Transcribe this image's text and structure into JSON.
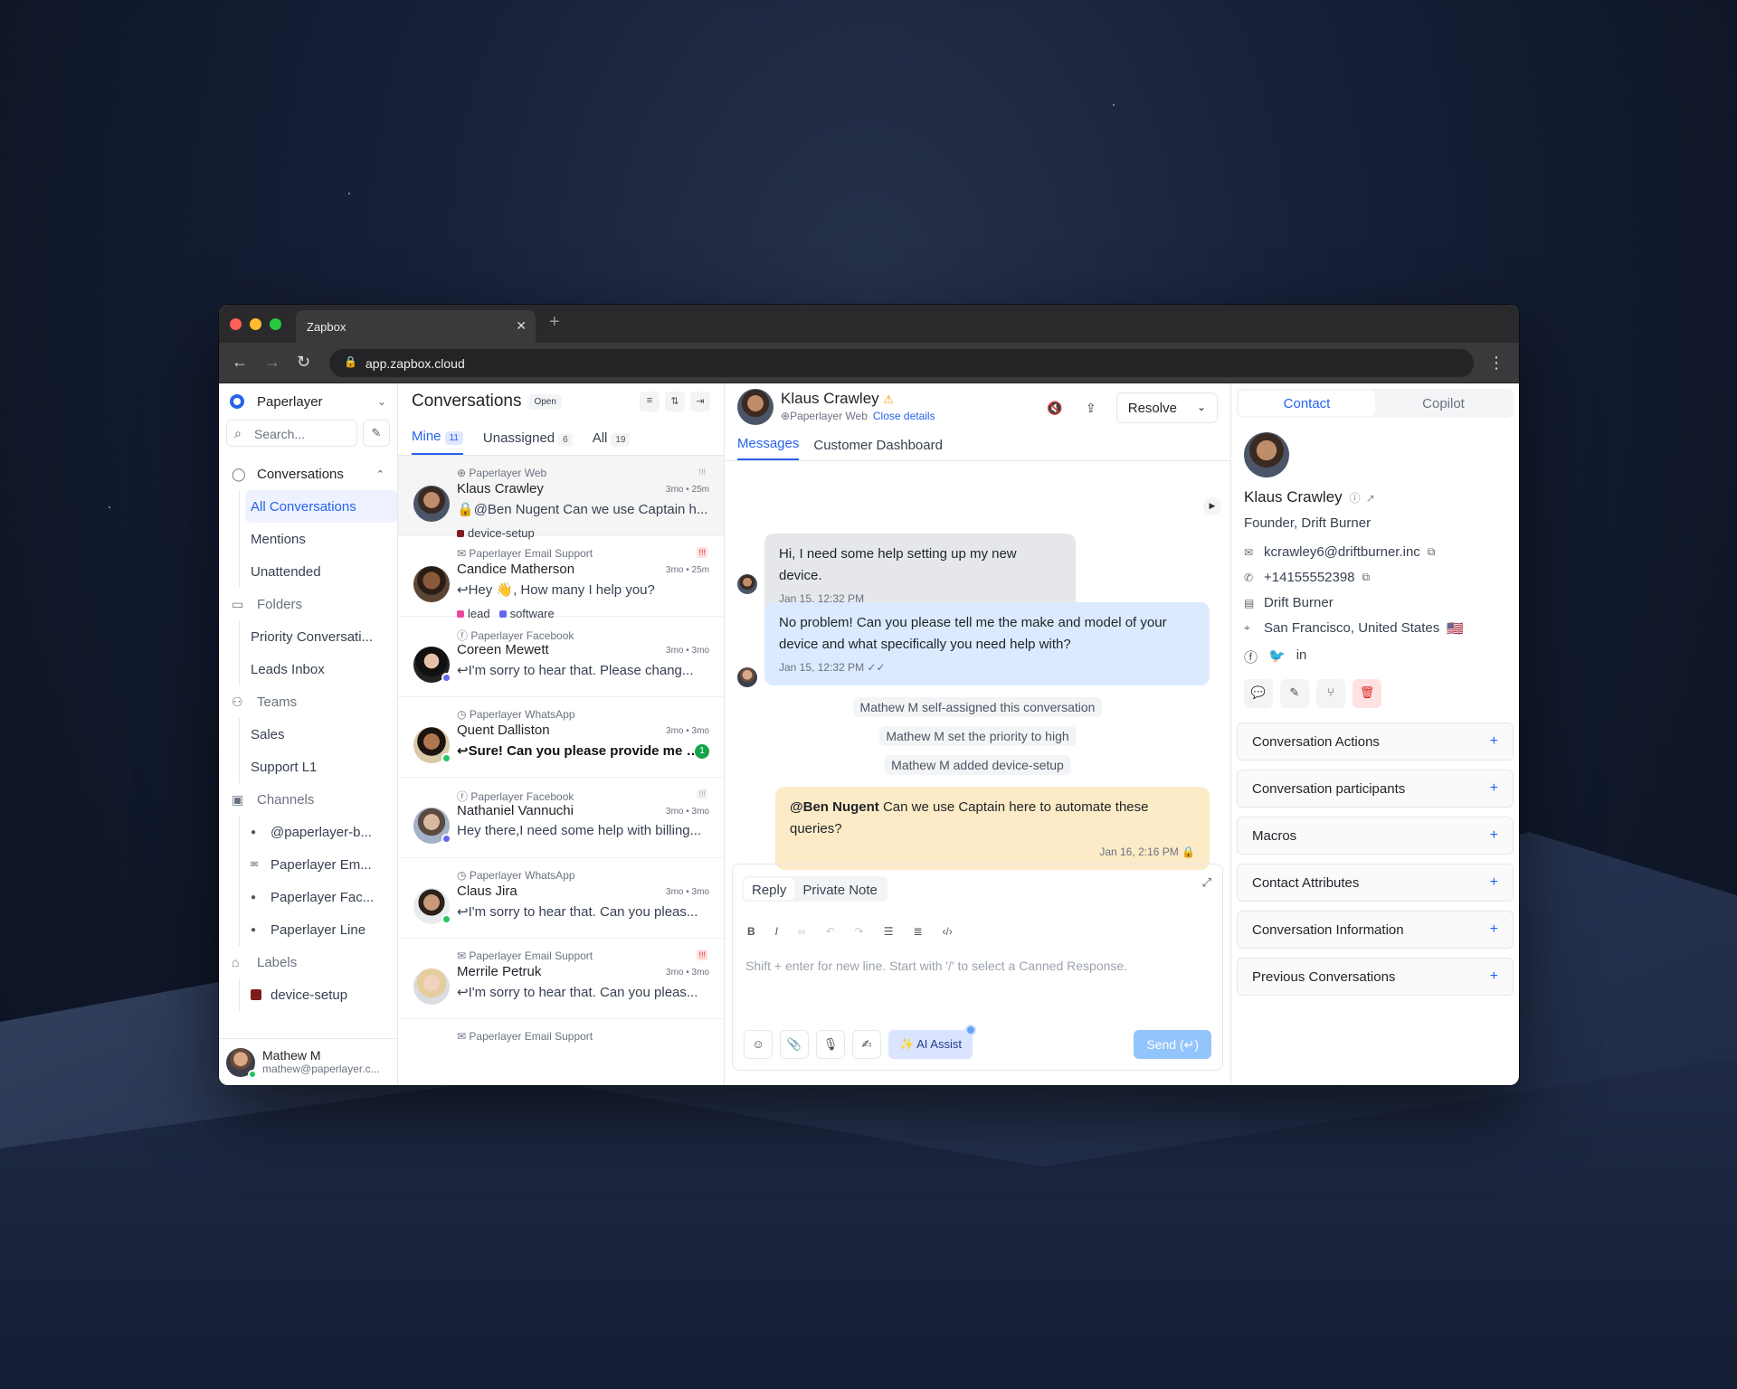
{
  "browser": {
    "tab_title": "Zapbox",
    "url": "app.zapbox.cloud"
  },
  "sidebar": {
    "workspace": "Paperlayer",
    "search_placeholder": "Search...",
    "conversations_header": "Conversations",
    "conv_items": [
      "All Conversations",
      "Mentions",
      "Unattended"
    ],
    "folders_header": "Folders",
    "folder_items": [
      "Priority Conversati...",
      "Leads Inbox"
    ],
    "teams_header": "Teams",
    "team_items": [
      "Sales",
      "Support L1"
    ],
    "channels_header": "Channels",
    "channel_items": [
      "@paperlayer-b...",
      "Paperlayer Em...",
      "Paperlayer Fac...",
      "Paperlayer Line"
    ],
    "labels_header": "Labels",
    "label_items": [
      "device-setup"
    ],
    "user": {
      "name": "Mathew M",
      "email": "mathew@paperlayer.c..."
    }
  },
  "convlist": {
    "title": "Conversations",
    "status": "Open",
    "tabs": [
      {
        "label": "Mine",
        "count": "11"
      },
      {
        "label": "Unassigned",
        "count": "6"
      },
      {
        "label": "All",
        "count": "19"
      }
    ],
    "items": [
      {
        "channel": "Paperlayer Web",
        "name": "Klaus Crawley",
        "time": "3mo • 25m",
        "message": "@Ben Nugent Can we use Captain h...",
        "tags": [
          "device-setup"
        ]
      },
      {
        "channel": "Paperlayer Email Support",
        "name": "Candice Matherson",
        "time": "3mo • 25m",
        "message": "Hey 👋, How many I help you?",
        "tags": [
          "lead",
          "software"
        ]
      },
      {
        "channel": "Paperlayer Facebook",
        "name": "Coreen Mewett",
        "time": "3mo • 3mo",
        "message": "I'm sorry to hear that. Please chang..."
      },
      {
        "channel": "Paperlayer WhatsApp",
        "name": "Quent Dalliston",
        "time": "3mo • 3mo",
        "message": "Sure! Can you please provide me wi...",
        "unread": "1"
      },
      {
        "channel": "Paperlayer Facebook",
        "name": "Nathaniel Vannuchi",
        "time": "3mo • 3mo",
        "message": "Hey there,I need some help with billing..."
      },
      {
        "channel": "Paperlayer WhatsApp",
        "name": "Claus Jira",
        "time": "3mo • 3mo",
        "message": "I'm sorry to hear that. Can you pleas..."
      },
      {
        "channel": "Paperlayer Email Support",
        "name": "Merrile Petruk",
        "time": "3mo • 3mo",
        "message": "I'm sorry to hear that. Can you pleas..."
      },
      {
        "channel": "Paperlayer Email Support"
      }
    ]
  },
  "chat": {
    "contact_name": "Klaus Crawley",
    "source": "Paperlayer Web",
    "close_details": "Close details",
    "resolve": "Resolve",
    "tabs": [
      "Messages",
      "Customer Dashboard"
    ],
    "messages": [
      {
        "text": "Hi, I need some help setting up my new device.",
        "time": "Jan 15, 12:32 PM"
      },
      {
        "text": "No problem! Can you please tell me the make and model of your device and what specifically you need help with?",
        "time": "Jan 15, 12:32 PM"
      }
    ],
    "activities": [
      "Mathew M self-assigned this conversation",
      "Mathew M set the priority to high",
      "Mathew M added device-setup"
    ],
    "note": {
      "mention": "@Ben Nugent",
      "text": " Can we use Captain here to automate these queries?",
      "time": "Jan 16, 2:16 PM"
    },
    "composer": {
      "tabs": [
        "Reply",
        "Private Note"
      ],
      "placeholder": "Shift + enter for new line. Start with '/' to select a Canned Response.",
      "ai_assist": "AI Assist",
      "send": "Send (↵)"
    }
  },
  "contact": {
    "tabs": [
      "Contact",
      "Copilot"
    ],
    "name": "Klaus Crawley",
    "role": "Founder, Drift Burner",
    "email": "kcrawley6@driftburner.inc",
    "phone": "+14155552398",
    "company": "Drift Burner",
    "location": "San Francisco, United States",
    "flag": "🇺🇸",
    "sections": [
      "Conversation Actions",
      "Conversation participants",
      "Macros",
      "Contact Attributes",
      "Conversation Information",
      "Previous Conversations"
    ]
  },
  "colors": {
    "accent": "#2563eb",
    "note_bg": "#fcebc6",
    "outgoing_bg": "#dbeafe",
    "incoming_bg": "#e5e7eb"
  }
}
